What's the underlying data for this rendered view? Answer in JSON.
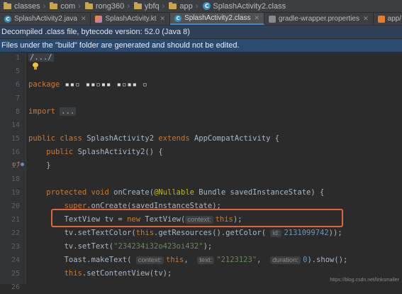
{
  "breadcrumb": [
    "classes",
    "com",
    "rong360",
    "ybfq",
    "app",
    "SplashActivity2.class"
  ],
  "tabs": [
    {
      "label": "SplashActivity2.java",
      "icon": "class-c-icon"
    },
    {
      "label": "SplashActivity.kt",
      "icon": "kotlin-file-icon"
    },
    {
      "label": "SplashActivity2.class",
      "icon": "class-c-icon",
      "active": true
    },
    {
      "label": "gradle-wrapper.properties",
      "icon": "properties-file-icon"
    },
    {
      "label": "app/.../AndroidM",
      "icon": "xml-file-icon"
    }
  ],
  "banners": {
    "decompiled": "Decompiled .class file, bytecode version: 52.0 (Java 8)",
    "generated": "Files under the \"build\" folder are generated and should not be edited."
  },
  "line_numbers": [
    "1",
    "5",
    "6",
    "7",
    "8",
    "14",
    "15",
    "16",
    "17",
    "18",
    "19",
    "20",
    "21",
    "22",
    "23",
    "24",
    "25",
    "26"
  ],
  "code": {
    "header_comment": "/.../",
    "package_kw": "package",
    "import_kw": "import",
    "import_fold": "...",
    "class_public": "public",
    "class_kw": "class",
    "class_name": "SplashActivity2",
    "extends_kw": "extends",
    "super_class": "AppCompatActivity {",
    "ctor_public": "public",
    "ctor_rest": "SplashActivity2() {",
    "close_brace": "}",
    "protected_kw": "protected",
    "void_kw": "void",
    "oncreate_sig": "onCreate(",
    "nullable_ann": "@Nullable",
    "oncreate_params": "Bundle savedInstanceState) {",
    "super_call_kw": "super",
    "super_call_rest": ".onCreate(savedInstanceState);",
    "textview_decl": "TextView tv = ",
    "new_kw": "new",
    "textview_ctor": "TextView(",
    "hint_context": "context:",
    "this_kw": "this",
    "paren_semi": ");",
    "settextcolor": "tv.setTextColor(",
    "getcolor": ".getResources().getColor(",
    "hint_id": "id:",
    "color_value": "2131099742",
    "double_close": "));",
    "settext": "tv.setText(",
    "settext_value": "\"234234i32o423oi432\"",
    "toast_call": "Toast.makeText(",
    "hint_text": "text:",
    "toast_text": "\"2123123\"",
    "hint_duration": "duration:",
    "duration_value": "0",
    "show_call": ").show();",
    "setcontentview": ".setContentView(tv);",
    "comma": ","
  },
  "watermark": "https://blog.csdn.net/linksmaller"
}
